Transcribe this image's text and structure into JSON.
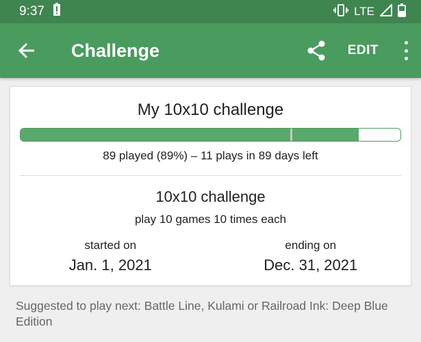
{
  "status_bar": {
    "time": "9:37",
    "network": "LTE"
  },
  "app_bar": {
    "title": "Challenge",
    "edit_label": "EDIT"
  },
  "challenge": {
    "heading": "My 10x10 challenge",
    "progress_fraction": 0.89,
    "expected_fraction": 0.71,
    "progress_text": "89 played (89%) – 11 plays in 89 days left",
    "type_name": "10x10 challenge",
    "type_description": "play 10 games 10 times each",
    "start_label": "started on",
    "start_date": "Jan. 1, 2021",
    "end_label": "ending on",
    "end_date": "Dec. 31, 2021"
  },
  "suggestion": "Suggested to play next: Battle Line, Kulami or Railroad Ink: Deep Blue Edition",
  "colors": {
    "status_bar": "#3f8550",
    "app_bar": "#4a9b5e",
    "progress_fill": "#5aa86b"
  },
  "icons": [
    "battery-alert-icon",
    "vibrate-icon",
    "signal-icon",
    "battery-icon",
    "back-arrow-icon",
    "share-icon",
    "more-vert-icon"
  ]
}
